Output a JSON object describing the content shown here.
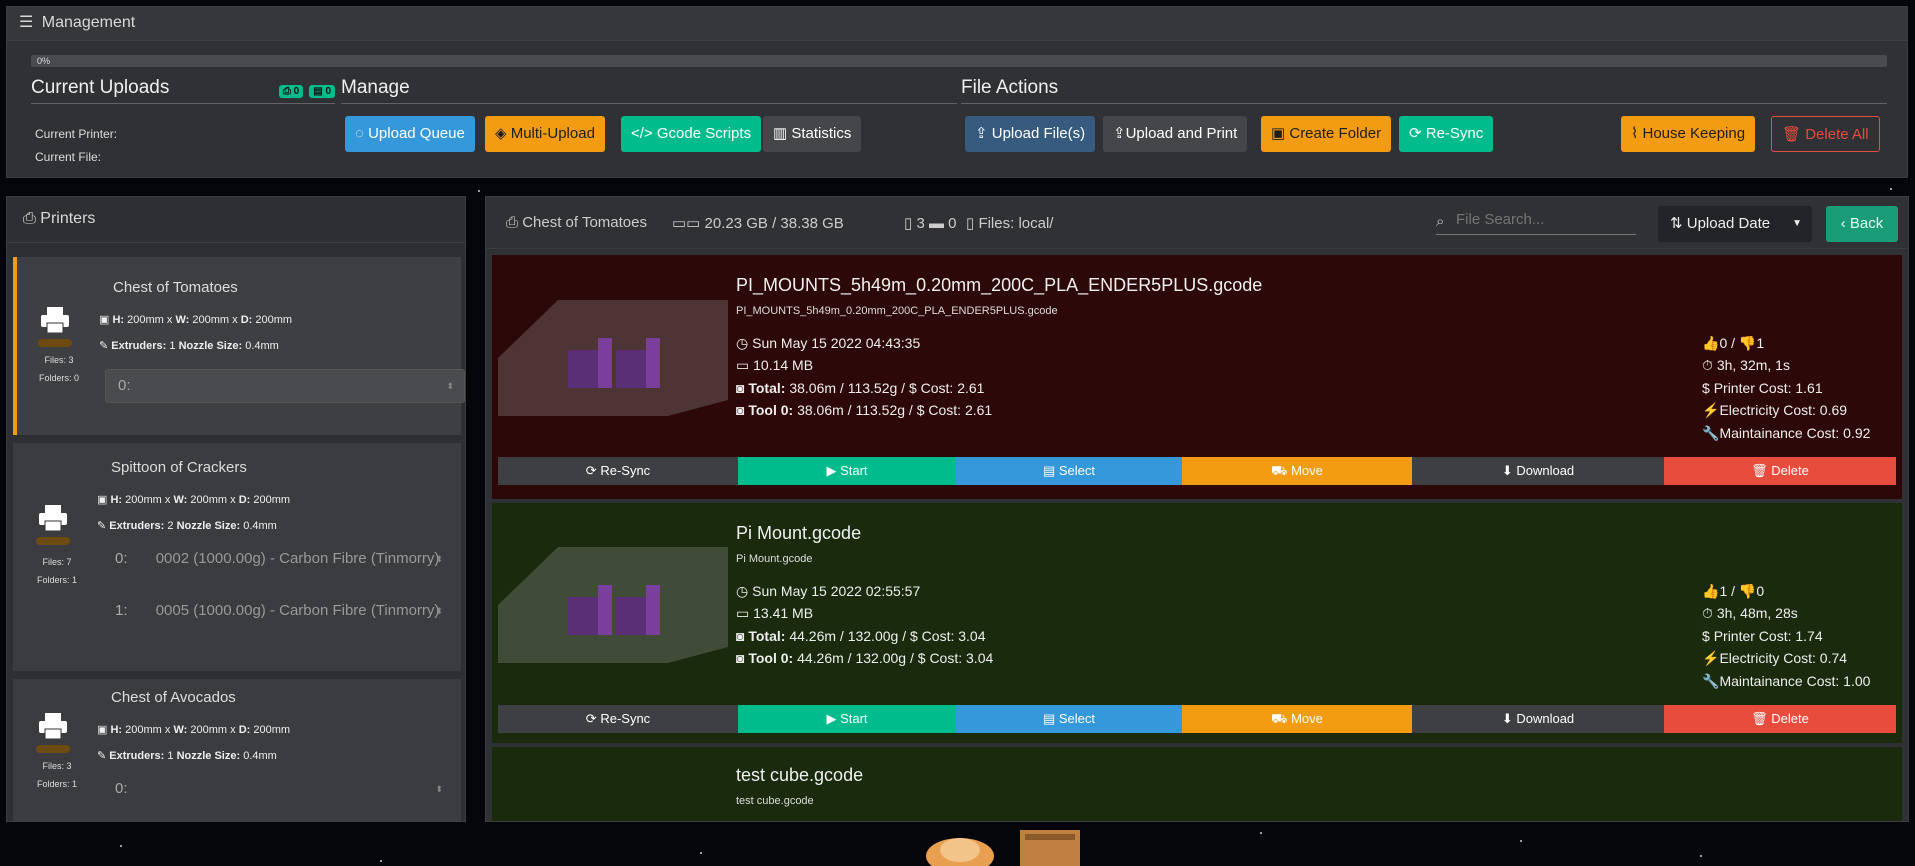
{
  "management": {
    "title": "Management",
    "progress_label": "0%",
    "progress_value": 0,
    "current_uploads": {
      "title": "Current Uploads",
      "badge_printers": "0",
      "badge_files": "0",
      "current_printer_label": "Current Printer:",
      "current_file_label": "Current File:"
    },
    "manage": {
      "title": "Manage",
      "upload_queue": "Upload Queue",
      "multi_upload": "Multi-Upload",
      "gcode_scripts": "Gcode Scripts",
      "statistics": "Statistics"
    },
    "file_actions": {
      "title": "File Actions",
      "upload_files": "Upload File(s)",
      "upload_and_print": "Upload and Print",
      "create_folder": "Create Folder",
      "resync": "Re-Sync",
      "house_keeping": "House Keeping",
      "delete_all": "Delete All"
    }
  },
  "printers": {
    "title": "Printers",
    "items": [
      {
        "name": "Chest of Tomatoes",
        "h": "200mm",
        "w": "200mm",
        "d": "200mm",
        "extruders": "1",
        "nozzle": "0.4mm",
        "files": "Files: 3",
        "folders": "Folders: 0",
        "tools": [
          "0:"
        ],
        "tool_options": [
          ""
        ]
      },
      {
        "name": "Spittoon of Crackers",
        "h": "200mm",
        "w": "200mm",
        "d": "200mm",
        "extruders": "2",
        "nozzle": "0.4mm",
        "files": "Files: 7",
        "folders": "Folders: 1",
        "tools": [
          "0:",
          "1:"
        ],
        "tool_options": [
          "0002 (1000.00g) - Carbon Fibre (Tinmorry)",
          "0005 (1000.00g) - Carbon Fibre (Tinmorry)"
        ]
      },
      {
        "name": "Chest of Avocados",
        "h": "200mm",
        "w": "200mm",
        "d": "200mm",
        "extruders": "1",
        "nozzle": "0.4mm",
        "files": "Files: 3",
        "folders": "Folders: 1",
        "tools": [
          "0:"
        ],
        "tool_options": [
          ""
        ]
      }
    ],
    "labels": {
      "h": "H:",
      "w": "W:",
      "d": "D:",
      "x": "x",
      "extruders": "Extruders:",
      "nozzle": "Nozzle Size:"
    }
  },
  "files_panel": {
    "printer_name": "Chest of Tomatoes",
    "storage": "20.23 GB / 38.38 GB",
    "file_count": "3",
    "folder_count": "0",
    "location": "Files: local/",
    "search_placeholder": "File Search...",
    "sort_label": "Upload Date",
    "back_label": "Back",
    "action_labels": {
      "resync": "Re-Sync",
      "start": "Start",
      "select": "Select",
      "move": "Move",
      "download": "Download",
      "delete": "Delete"
    },
    "files": [
      {
        "title": "PI_MOUNTS_5h49m_0.20mm_200C_PLA_ENDER5PLUS.gcode",
        "subtitle": "PI_MOUNTS_5h49m_0.20mm_200C_PLA_ENDER5PLUS.gcode",
        "date": "Sun May 15 2022 04:43:35",
        "size": "10.14 MB",
        "total_label": "Total:",
        "total": "38.06m / 113.52g /",
        "cost_label": "Cost:",
        "total_cost": "2.61",
        "tool0_label": "Tool 0:",
        "tool0": "38.06m / 113.52g /",
        "tool0_cost": "2.61",
        "votes_up": "0",
        "votes_down": "1",
        "print_time": "3h, 32m, 1s",
        "printer_cost": "Printer Cost: 1.61",
        "electricity_cost": "Electricity Cost: 0.69",
        "maintenance_cost": "Maintainance Cost: 0.92"
      },
      {
        "title": "Pi Mount.gcode",
        "subtitle": "Pi Mount.gcode",
        "date": "Sun May 15 2022 02:55:57",
        "size": "13.41 MB",
        "total_label": "Total:",
        "total": "44.26m / 132.00g /",
        "cost_label": "Cost:",
        "total_cost": "3.04",
        "tool0_label": "Tool 0:",
        "tool0": "44.26m / 132.00g /",
        "tool0_cost": "3.04",
        "votes_up": "1",
        "votes_down": "0",
        "print_time": "3h, 48m, 28s",
        "printer_cost": "Printer Cost: 1.74",
        "electricity_cost": "Electricity Cost: 0.74",
        "maintenance_cost": "Maintainance Cost: 1.00"
      },
      {
        "title": "test cube.gcode",
        "subtitle": "test cube.gcode"
      }
    ]
  },
  "colors": {
    "teal": "#00bc8c",
    "blue": "#3498db",
    "orange": "#f39c12",
    "red": "#e74c3c",
    "navy": "#375a7f"
  }
}
